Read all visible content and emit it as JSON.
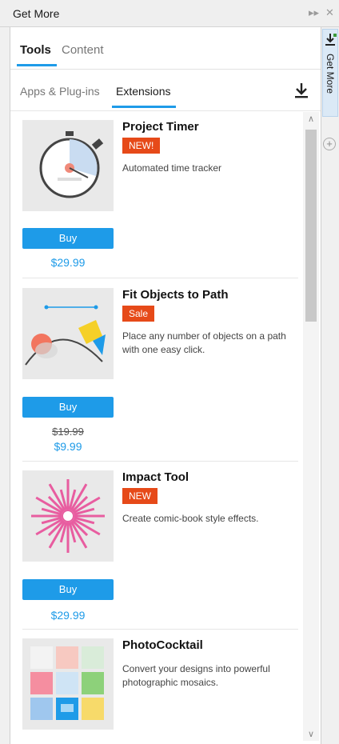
{
  "window": {
    "title": "Get More",
    "pin_icon": "pin-icon",
    "close_icon": "close-icon"
  },
  "tabs_primary": [
    {
      "label": "Tools"
    },
    {
      "label": "Content"
    }
  ],
  "tabs_secondary": [
    {
      "label": "Apps & Plug-ins"
    },
    {
      "label": "Extensions"
    }
  ],
  "download_icon": "download-icon",
  "items": [
    {
      "name": "Project Timer",
      "badge": "NEW!",
      "description": "Automated time tracker",
      "buy_label": "Buy",
      "price": "$29.99",
      "old_price": "",
      "icon": "stopwatch-icon"
    },
    {
      "name": "Fit Objects to Path",
      "badge": "Sale",
      "description": "Place any number of objects on a path with one easy click.",
      "buy_label": "Buy",
      "price": "$9.99",
      "old_price": "$19.99",
      "icon": "curve-path-icon"
    },
    {
      "name": "Impact Tool",
      "badge": "NEW",
      "description": "Create comic-book style effects.",
      "buy_label": "Buy",
      "price": "$29.99",
      "old_price": "",
      "icon": "starburst-icon"
    },
    {
      "name": "PhotoCocktail",
      "badge": "",
      "description": "Convert your designs into powerful photographic mosaics.",
      "buy_label": "",
      "price": "",
      "old_price": "",
      "icon": "mosaic-icon"
    }
  ],
  "side_dock": {
    "tab_label": "Get More",
    "add_icon": "plus-circle-icon"
  },
  "colors": {
    "accent": "#1e9be8",
    "badge": "#e64a19"
  }
}
